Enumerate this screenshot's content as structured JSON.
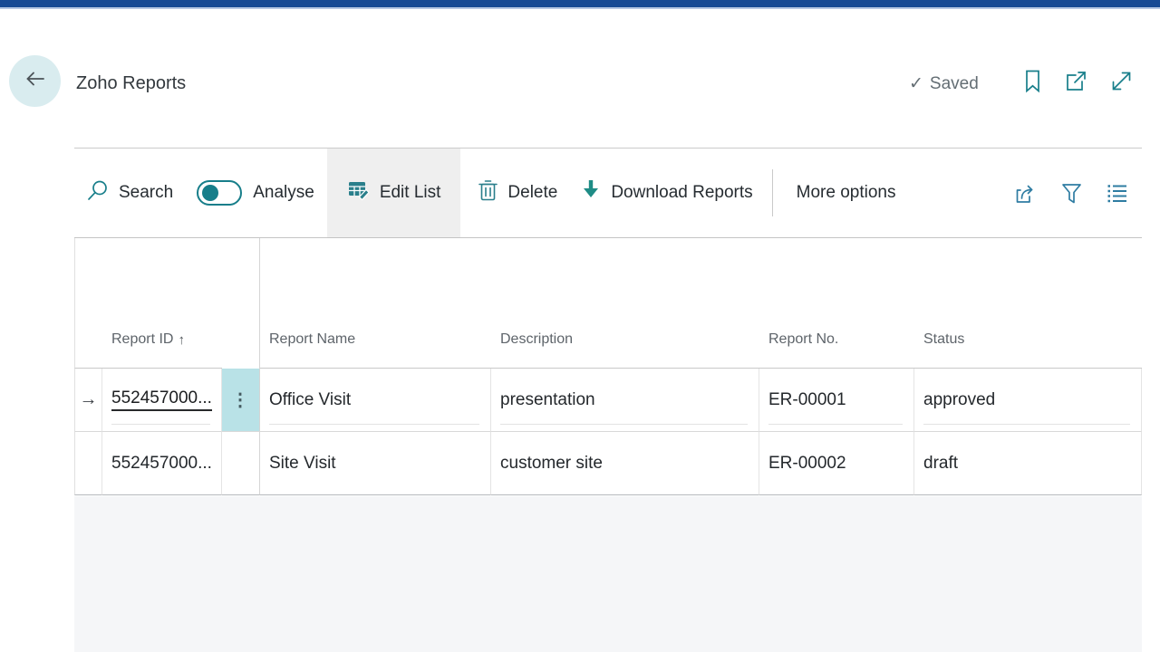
{
  "header": {
    "title": "Zoho Reports",
    "saved_check": "✓",
    "saved_label": "Saved"
  },
  "toolbar": {
    "search_label": "Search",
    "analyse_label": "Analyse",
    "edit_list_label": "Edit List",
    "delete_label": "Delete",
    "download_label": "Download Reports",
    "more_options_label": "More options"
  },
  "table": {
    "columns": {
      "report_id": "Report ID",
      "report_name": "Report Name",
      "description": "Description",
      "report_no": "Report No.",
      "status": "Status"
    },
    "sort_indicator": "↑",
    "rows": [
      {
        "marker": "→",
        "report_id": "552457000...",
        "row_menu": "⋮",
        "report_name": "Office Visit",
        "description": "presentation",
        "report_no": "ER-00001",
        "status": "approved"
      },
      {
        "marker": "",
        "report_id": "552457000...",
        "row_menu": "",
        "report_name": "Site Visit",
        "description": "customer site",
        "report_no": "ER-00002",
        "status": "draft"
      }
    ]
  },
  "icons": {
    "header_right": [
      "bookmark-icon",
      "popout-icon",
      "expand-icon"
    ],
    "toolbar_left": [
      "search-icon",
      "analyse-toggle",
      "edit-list-icon",
      "delete-icon",
      "download-icon"
    ],
    "toolbar_right": [
      "share-icon",
      "filter-icon",
      "column-list-icon"
    ],
    "misc": [
      "back-arrow-icon",
      "check-icon",
      "sort-up-icon",
      "row-marker-icon",
      "row-menu-icon"
    ]
  },
  "colors": {
    "topbar": "#174a94",
    "topbar_edge": "#b6c7e3",
    "accent_teal": "#177e8a",
    "toolbar_icon_blue": "#2e7ca2",
    "back_circle_bg": "#d9ecef",
    "row_menu_bg": "#b9e2e7",
    "edit_list_bg": "#efefef",
    "filler_bg": "#f5f6f8"
  }
}
